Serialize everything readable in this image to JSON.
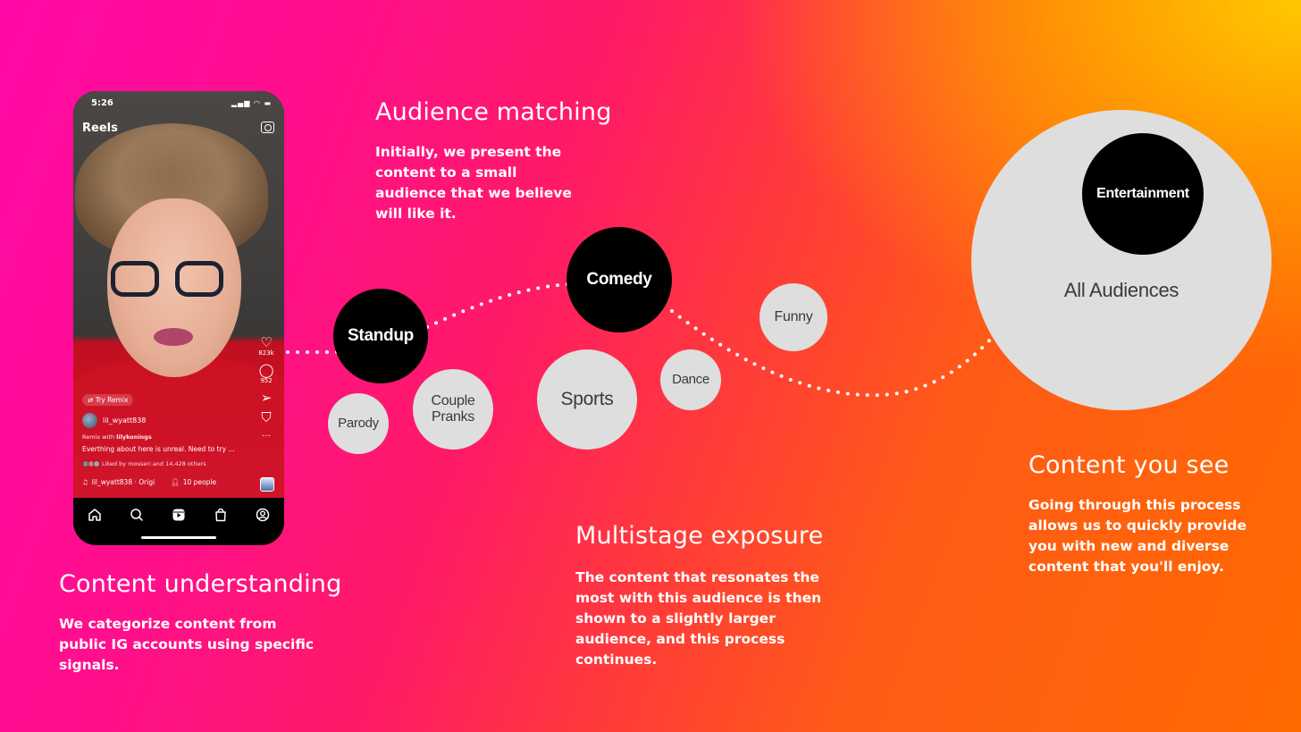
{
  "phone": {
    "status_time": "5:26",
    "status_icons": "signal wifi battery",
    "header_title": "Reels",
    "header_icon": "camera-icon",
    "actions": [
      {
        "icon": "heart-icon",
        "glyph": "♡",
        "count": "823k"
      },
      {
        "icon": "comment-icon",
        "glyph": "◯",
        "count": "952"
      },
      {
        "icon": "share-icon",
        "glyph": "➢",
        "count": ""
      },
      {
        "icon": "bookmark-icon",
        "glyph": "⛉",
        "count": ""
      },
      {
        "icon": "more-icon",
        "glyph": "···",
        "count": ""
      }
    ],
    "try_remix_label": "Try Remix",
    "username": "lil_wyatt838",
    "remix_prefix": "Remix with",
    "remix_user": "lilykonings",
    "caption": "Everthing about here is unreal. Need to try ...",
    "liked_by": "Liked by mosseri and 14,428 others",
    "audio_label": "lil_wyatt838 · Origi",
    "people_label": "10 people",
    "nav": [
      {
        "icon": "home-icon"
      },
      {
        "icon": "search-icon"
      },
      {
        "icon": "reels-icon"
      },
      {
        "icon": "shop-icon"
      },
      {
        "icon": "profile-icon"
      }
    ]
  },
  "sections": {
    "audience_matching": {
      "title": "Audience matching",
      "body": "Initially, we present the content to a small audience that we believe will like it."
    },
    "content_understanding": {
      "title": "Content understanding",
      "body": "We categorize content from public IG accounts using specific signals."
    },
    "multistage_exposure": {
      "title": "Multistage exposure",
      "body": "The content that resonates the most with this audience is then shown to a slightly larger audience, and this process continues."
    },
    "content_you_see": {
      "title": "Content you see",
      "body": "Going through this process allows us to quickly provide you with new and diverse content that you'll enjoy."
    }
  },
  "bubbles": {
    "standup": {
      "label": "Standup",
      "style": "dark"
    },
    "comedy": {
      "label": "Comedy",
      "style": "dark"
    },
    "entertainment": {
      "label": "Entertainment",
      "style": "dark"
    },
    "parody": {
      "label": "Parody",
      "style": "light"
    },
    "couple_pranks": {
      "label_1": "Couple",
      "label_2": "Pranks",
      "style": "light"
    },
    "sports": {
      "label": "Sports",
      "style": "light"
    },
    "dance": {
      "label": "Dance",
      "style": "light"
    },
    "funny": {
      "label": "Funny",
      "style": "light"
    },
    "all_audiences": {
      "label": "All Audiences",
      "style": "light"
    }
  },
  "colors": {
    "bg_top_left": "#ff0f8c",
    "bg_bottom_left": "#ff00b0",
    "bg_top_right": "#ffc800",
    "bg_bottom_right": "#ff5a00",
    "bubble_dark": "#000000",
    "bubble_light": "#dedede",
    "text": "#ffffff"
  }
}
